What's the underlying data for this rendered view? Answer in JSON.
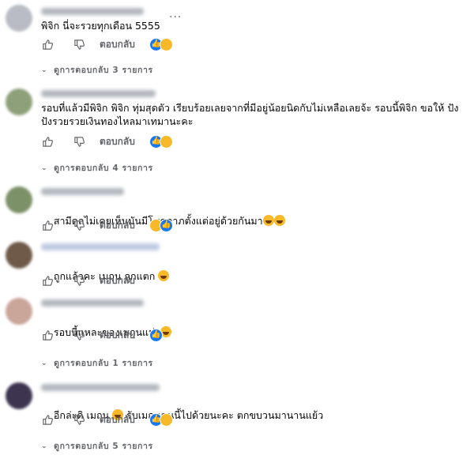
{
  "ui": {
    "reply_label": "ตอบกลับ",
    "more_dots": "···"
  },
  "colors": {
    "like_blue": "#1877f2",
    "haha_yellow": "#f7b928",
    "muted_text": "#65676b"
  },
  "comments": [
    {
      "text": "พิจิก นี่จะรวยทุกเดือน 5555",
      "reactions": [
        "like",
        "haha"
      ],
      "view_replies": "ดูการตอบกลับ 3 รายการ",
      "has_more_menu": true
    },
    {
      "text": "รอบที่แล้วมีพิจิก พิจิก ทุ่มสุดตัว เรียบร้อยเลยจากที่มีอยู่น้อยนิดกับไม่เหลือเลยจ้ะ รอบนี้พิจิก ขอให้ ปังปังรวยรวยเงินทองไหลมาเทมานะคะ",
      "reactions": [
        "like",
        "haha"
      ],
      "view_replies": "ดูการตอบกลับ 4 รายการ"
    },
    {
      "text": "สามีดุลไม่เคยเห็นมันมีโชคลาภตั้งแต่อยู่ด้วยกันมา",
      "trailing_emojis": [
        "laughing-face-emoji",
        "rolling-laughing-emoji"
      ],
      "reactions": [
        "haha",
        "like"
      ],
      "view_replies": ""
    },
    {
      "text": "ถูกแล้วคะ เมถุน ถูกแตก",
      "trailing_emojis": [
        "rolling-laughing-emoji"
      ],
      "reactions": [],
      "view_replies": ""
    },
    {
      "text": "รอบนี้แหละของเมถุนแน่ๆ",
      "trailing_emojis": [
        "grinning-face-emoji"
      ],
      "reactions": [
        "like"
      ],
      "view_replies": "ดูการตอบกลับ 1 รายการ"
    },
    {
      "text_before": "อีกล่ะดิ เมถุน",
      "text_after": "รับเมถุนคนนี้ไปด้วยนะคะ ตกขบวนมานานแย้ว",
      "reactions": [
        "like",
        "haha"
      ],
      "view_replies": "ดูการตอบกลับ 5 รายการ"
    }
  ]
}
